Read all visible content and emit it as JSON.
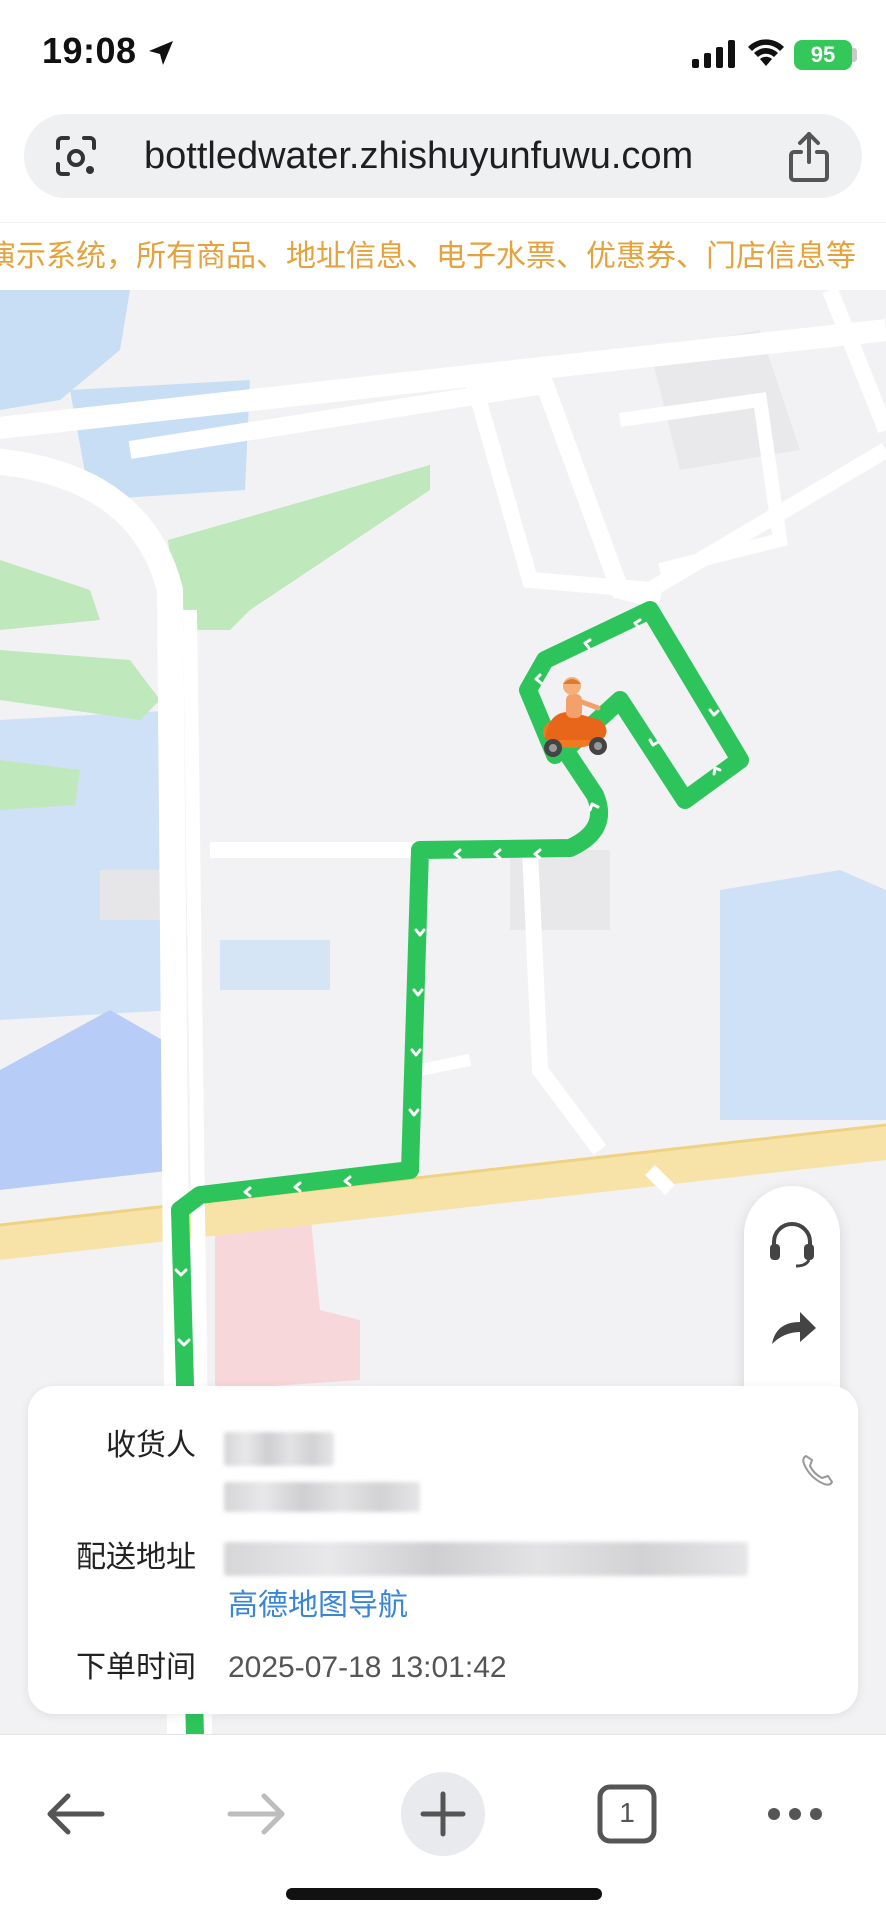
{
  "status_bar": {
    "time": "19:08",
    "battery": "95"
  },
  "browser": {
    "url": "bottledwater.zhishuyunfuwu.com"
  },
  "marquee": {
    "text": "演示系统，所有商品、地址信息、电子水票、优惠券、门店信息等"
  },
  "map": {
    "route_color": "#2ec45c",
    "courier_icon": "scooter-rider-icon"
  },
  "fab": {
    "items": [
      "headset-icon",
      "share-arrow-icon",
      "store-icon"
    ]
  },
  "order_info": {
    "recipient_label": "收货人",
    "address_label": "配送地址",
    "nav_link": "高德地图导航",
    "time_label": "下单时间",
    "order_time": "2025-07-18 13:01:42"
  },
  "toolbar": {
    "tab_count": "1"
  },
  "colors": {
    "accent": "#3a86d6",
    "marquee": "#e6a23c",
    "battery": "#34c759"
  }
}
